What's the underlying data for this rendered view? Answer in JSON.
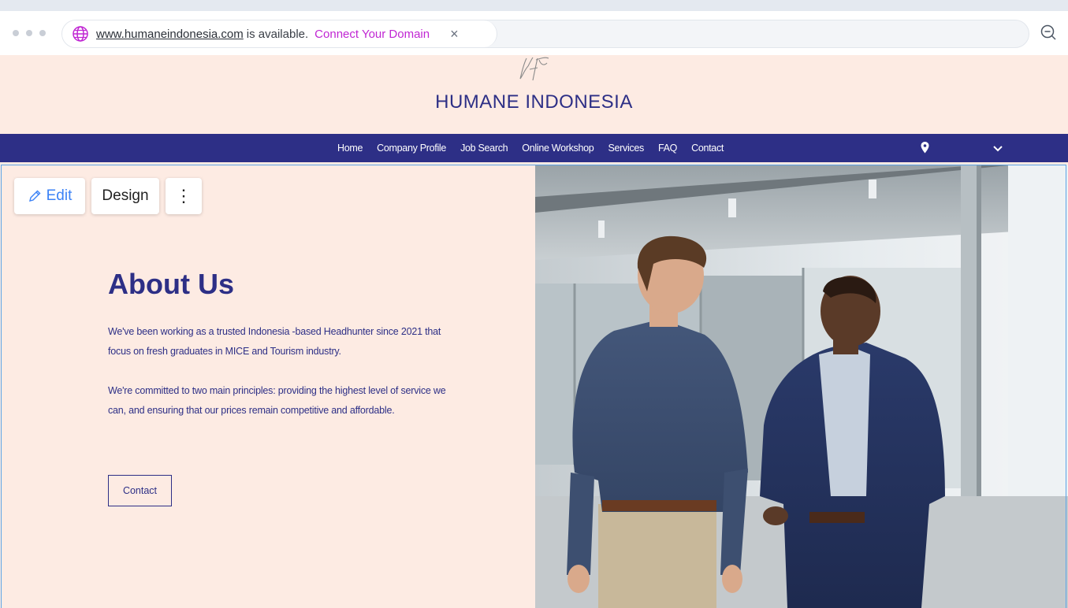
{
  "banner": {
    "domain": "www.humaneindonesia.com",
    "available_text": "is available.",
    "connect_label": "Connect Your Domain",
    "close_glyph": "×"
  },
  "site": {
    "logo_text": "HI",
    "title": "HUMANE INDONESIA"
  },
  "nav": {
    "items": [
      "Home",
      "Company Profile",
      "Job Search",
      "Online Workshop",
      "Services",
      "FAQ",
      "Contact"
    ]
  },
  "editor": {
    "edit_label": "Edit",
    "design_label": "Design",
    "more_glyph": "⋮"
  },
  "about": {
    "title": "About Us",
    "paragraph1": "We've been working as a trusted Indonesia -based Headhunter since 2021 that focus on fresh graduates in MICE and Tourism industry.",
    "paragraph2": "We're committed to two main principles: providing the highest level of service we can, and ensuring that our prices remain competitive and affordable.",
    "contact_label": "Contact"
  },
  "colors": {
    "brand_navy": "#2d2f86",
    "header_bg": "#fdebe3",
    "connect_pink": "#c026d3",
    "edit_blue": "#3b82f6"
  },
  "icons": [
    "globe-icon",
    "close-icon",
    "zoom-out-icon",
    "location-pin-icon",
    "chevron-down-icon",
    "pencil-icon",
    "more-vertical-icon"
  ]
}
